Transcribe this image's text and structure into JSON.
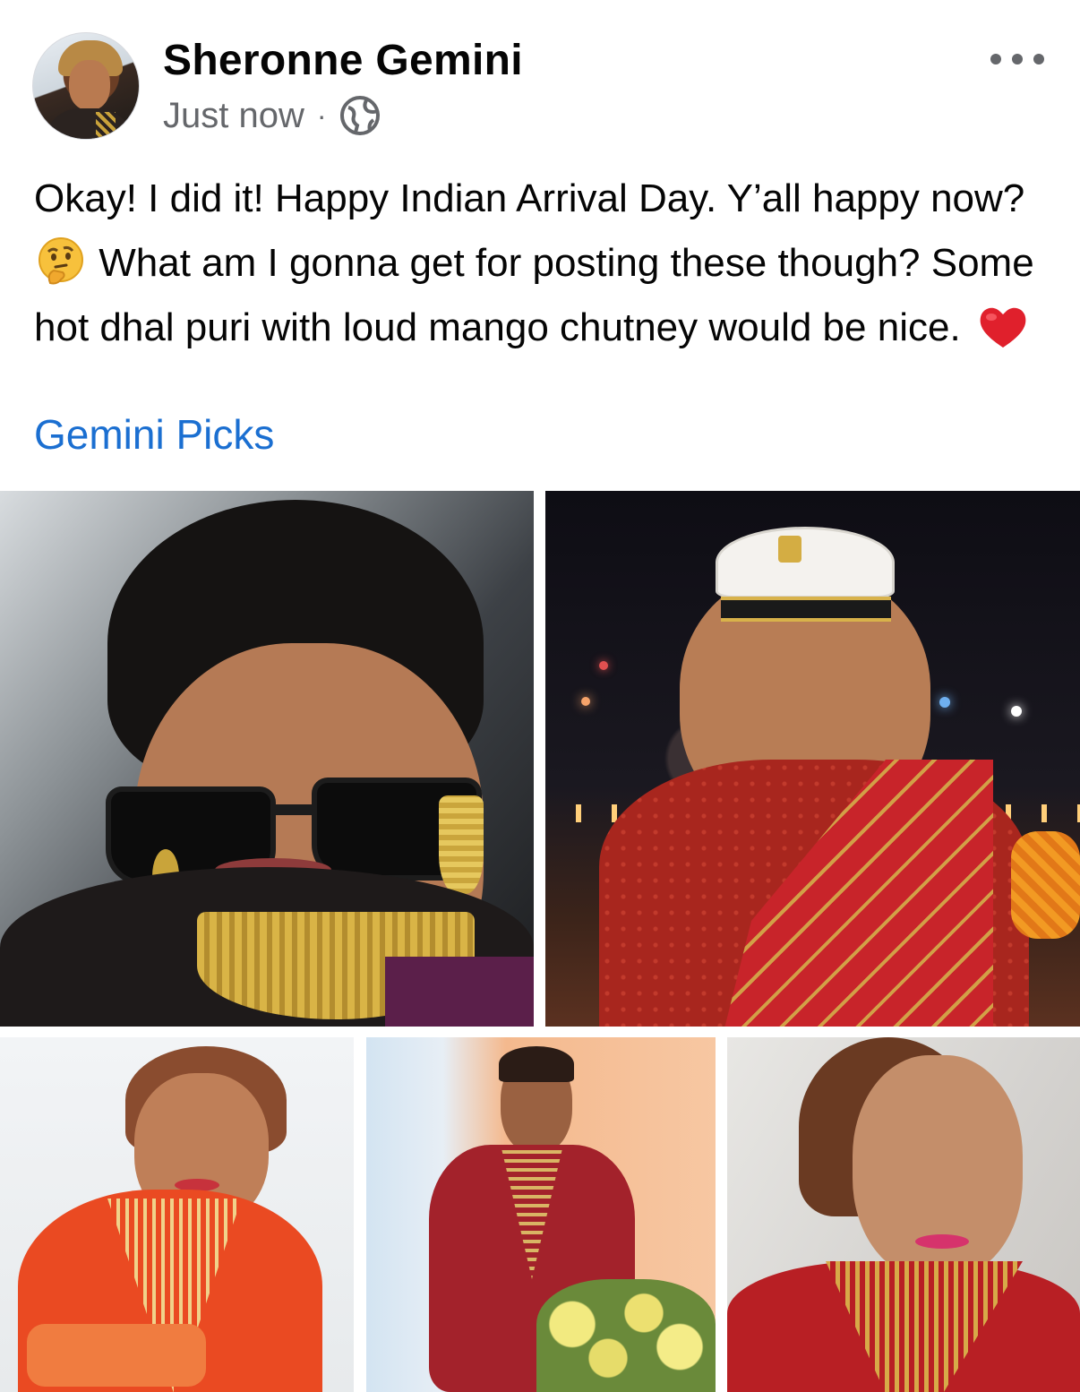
{
  "post": {
    "author_name": "Sheronne Gemini",
    "timestamp": "Just now",
    "separator": "·",
    "privacy_icon": "globe-icon",
    "more_icon": "more-options-icon",
    "text_part1": "Okay! I did it! Happy Indian Arrival Day. Y’all happy now?",
    "text_part2": "What am I gonna get for posting these though? Some hot dhal puri with loud mango chutney would be nice.",
    "emoji_1": "thinking-face-icon",
    "emoji_2": "red-heart-icon",
    "page_link": "Gemini Picks",
    "photo_count": 5
  },
  "colors": {
    "link_blue": "#1b6fd1",
    "meta_gray": "#65676b",
    "text_black": "#050505"
  }
}
